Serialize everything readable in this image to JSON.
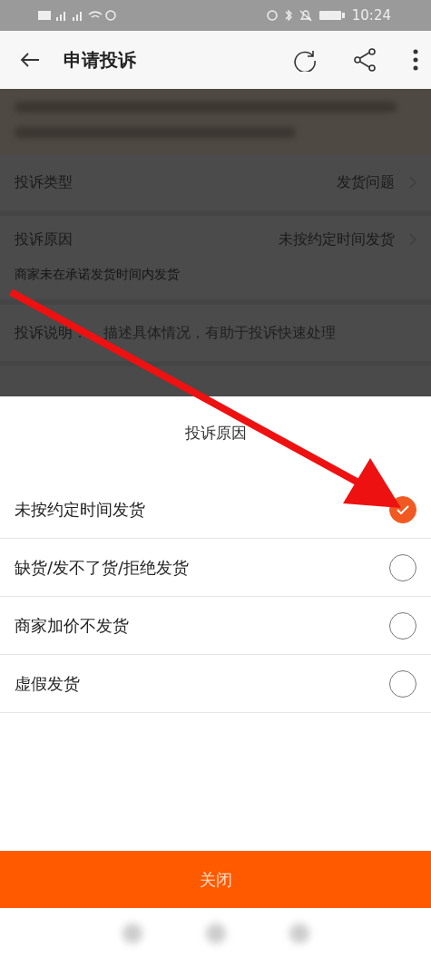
{
  "status_bar": {
    "time": "10:24"
  },
  "app_bar": {
    "title": "申请投诉"
  },
  "form": {
    "rows": [
      {
        "kind": "select",
        "label": "投诉类型",
        "value": "发货问题"
      },
      {
        "kind": "select",
        "label": "投诉原因",
        "value": "未按约定时间发货",
        "hint": "商家未在承诺发货时间内发货"
      },
      {
        "kind": "text",
        "label": "投诉说明：",
        "placeholder": "描述具体情况，有助于投诉快速处理"
      }
    ]
  },
  "sheet": {
    "title": "投诉原因",
    "options": [
      {
        "label": "未按约定时间发货",
        "selected": true
      },
      {
        "label": "缺货/发不了货/拒绝发货",
        "selected": false
      },
      {
        "label": "商家加价不发货",
        "selected": false
      },
      {
        "label": "虚假发货",
        "selected": false
      }
    ],
    "close_button": "关闭"
  }
}
